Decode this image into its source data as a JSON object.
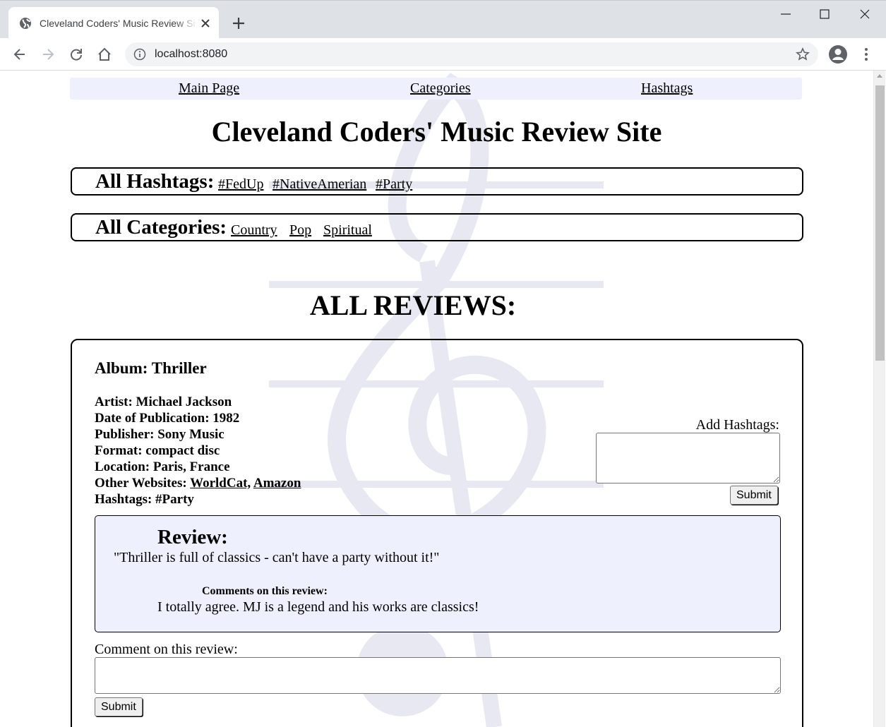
{
  "browser": {
    "tab_title": "Cleveland Coders' Music Review Site",
    "url": "localhost:8080"
  },
  "nav": {
    "main_page": "Main Page",
    "categories": "Categories",
    "hashtags": "Hashtags"
  },
  "site_title": "Cleveland Coders' Music Review Site",
  "all_hashtags": {
    "label": "All Hashtags:",
    "items": [
      "#FedUp",
      "#NativeAmerian",
      "#Party"
    ]
  },
  "all_categories": {
    "label": "All Categories:",
    "items": [
      "Country",
      "Pop",
      "Spiritual"
    ]
  },
  "reviews_heading": "ALL REVIEWS:",
  "review": {
    "album": "Album: Thriller",
    "artist": "Artist: Michael Jackson",
    "date": "Date of Publication: 1982",
    "publisher": "Publisher: Sony Music",
    "format": "Format: compact disc",
    "location": "Location: Paris, France",
    "other_websites_label": "Other Websites:",
    "websites": [
      "WorldCat,",
      "Amazon"
    ],
    "hashtags": "Hashtags: #Party",
    "add_hashtags_label": "Add Hashtags:",
    "add_hashtags_submit": "Submit",
    "review_label": "Review:",
    "review_text": "\"Thriller is full of classics - can't have a party without it!\"",
    "comments_label": "Comments on this review:",
    "comment": "I totally agree. MJ is a legend and his works are classics!",
    "comment_input_label": "Comment on this review:",
    "comment_submit": "Submit"
  },
  "colors": {
    "nav_bg": "#eff0fd",
    "review_bg": "#eff0fd",
    "chrome_bg": "#dee1e6",
    "omnibox_bg": "#f1f3f4",
    "watermark": "#e7e8f1"
  },
  "icons": [
    "globe-icon",
    "close-icon",
    "plus-icon",
    "minimize-icon",
    "maximize-icon",
    "back-icon",
    "forward-icon",
    "reload-icon",
    "home-icon",
    "info-icon",
    "star-icon",
    "profile-icon",
    "menu-icon",
    "treble-clef-icon"
  ]
}
